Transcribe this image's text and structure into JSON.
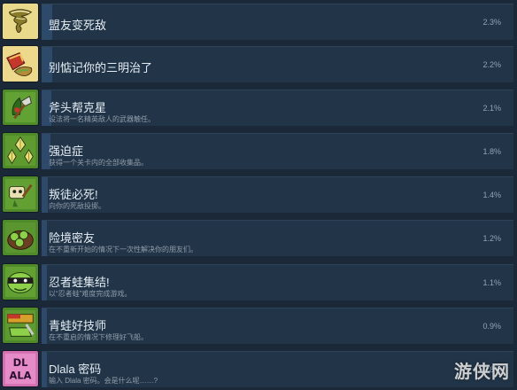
{
  "achievements": [
    {
      "title": "盟友变死敌",
      "description": "",
      "percent": "2.3%",
      "icon": "tornado-icon",
      "progress": 0.023
    },
    {
      "title": "别惦记你的三明治了",
      "description": "",
      "percent": "2.2%",
      "icon": "sandwich-icon",
      "progress": 0.022
    },
    {
      "title": "斧头帮克星",
      "description": "设法将一名精英敌人的武器触任。",
      "percent": "2.1%",
      "icon": "axe-leaf-icon",
      "progress": 0.021
    },
    {
      "title": "强迫症",
      "description": "获得一个关卡内的全部收集品。",
      "percent": "1.8%",
      "icon": "crystals-icon",
      "progress": 0.018
    },
    {
      "title": "叛徒必死!",
      "description": "向你的死敌投掷。",
      "percent": "1.4%",
      "icon": "throw-icon",
      "progress": 0.014
    },
    {
      "title": "险境密友",
      "description": "在不重新开始的情况下一次性解决你的朋友们。",
      "percent": "1.2%",
      "icon": "frog-group-icon",
      "progress": 0.012
    },
    {
      "title": "忍者蛙集结!",
      "description": "以“忍者蛙”难度完成游戏。",
      "percent": "1.1%",
      "icon": "ninja-frog-icon",
      "progress": 0.011
    },
    {
      "title": "青蛙好技师",
      "description": "在不重启的情况下修理好飞船。",
      "percent": "0.9%",
      "icon": "wrench-frog-icon",
      "progress": 0.009
    },
    {
      "title": "Dlala 密码",
      "description": "输入 Dlala 密码。会是什么呢……?",
      "percent": "0.8%",
      "icon": "dlala-icon",
      "progress": 0.008
    }
  ],
  "watermark": "游侠网",
  "colors": {
    "background": "#1b2838",
    "row": "#223548",
    "fill": "#2e4a6a",
    "title": "#e6eef5",
    "desc": "#8f9caa"
  }
}
